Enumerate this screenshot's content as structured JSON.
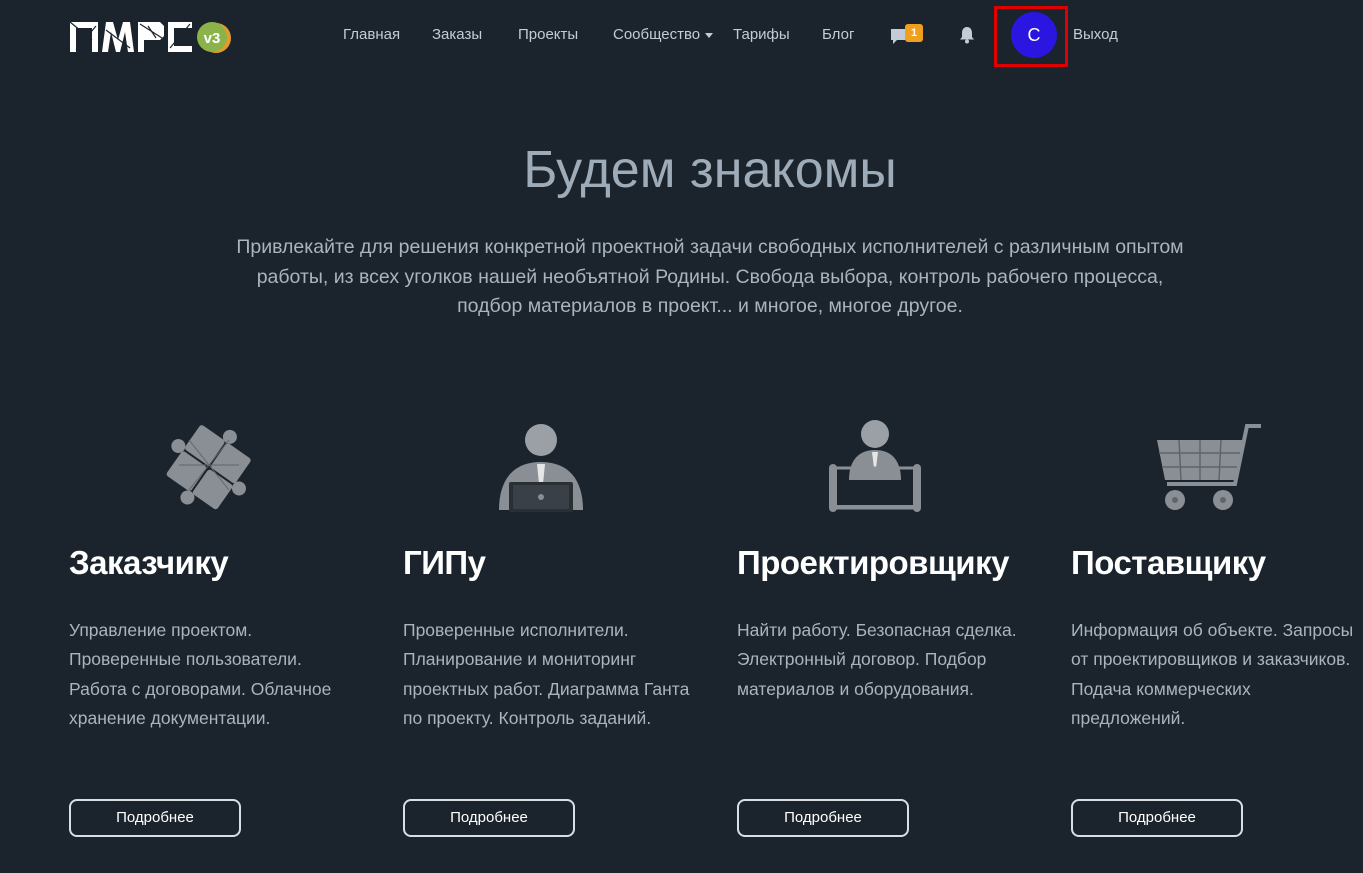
{
  "header": {
    "logo_text": "ПМРС",
    "logo_version": "v3",
    "nav": [
      {
        "label": "Главная"
      },
      {
        "label": "Заказы"
      },
      {
        "label": "Проекты"
      },
      {
        "label": "Сообщество"
      },
      {
        "label": "Тарифы"
      },
      {
        "label": "Блог"
      }
    ],
    "messages_badge": "1",
    "avatar_initial": "С",
    "logout_label": "Выход"
  },
  "hero": {
    "title": "Будем знакомы",
    "text": "Привлекайте для решения конкретной проектной задачи свободных исполнителей с различным опытом работы, из всех уголков нашей необъятной Родины. Свобода выбора, контроль рабочего процесса, подбор материалов в проект... и многое, многое другое."
  },
  "cards": [
    {
      "title": "Заказчику",
      "text": "Управление проектом. Проверенные пользователи. Работа с договорами. Облачное хранение документации.",
      "button": "Подробнее",
      "icon": "puzzle-icon"
    },
    {
      "title": "ГИПу",
      "text": "Проверенные исполнители. Планирование и мониторинг проектных работ. Диаграмма Ганта по проекту. Контроль заданий.",
      "button": "Подробнее",
      "icon": "manager-laptop-icon"
    },
    {
      "title": "Проектировщику",
      "text": "Найти работу. Безопасная сделка. Электронный договор. Подбор материалов и оборудования.",
      "button": "Подробнее",
      "icon": "designer-blueprint-icon"
    },
    {
      "title": "Поставщику",
      "text": "Информация об объекте. Запросы от проектировщиков и заказчиков. Подача коммерческих предложений.",
      "button": "Подробнее",
      "icon": "shopping-cart-icon"
    }
  ],
  "colors": {
    "background": "#1b242c",
    "avatar": "#2a16e0",
    "badge": "#f0a020",
    "highlight_frame": "#e00000"
  }
}
